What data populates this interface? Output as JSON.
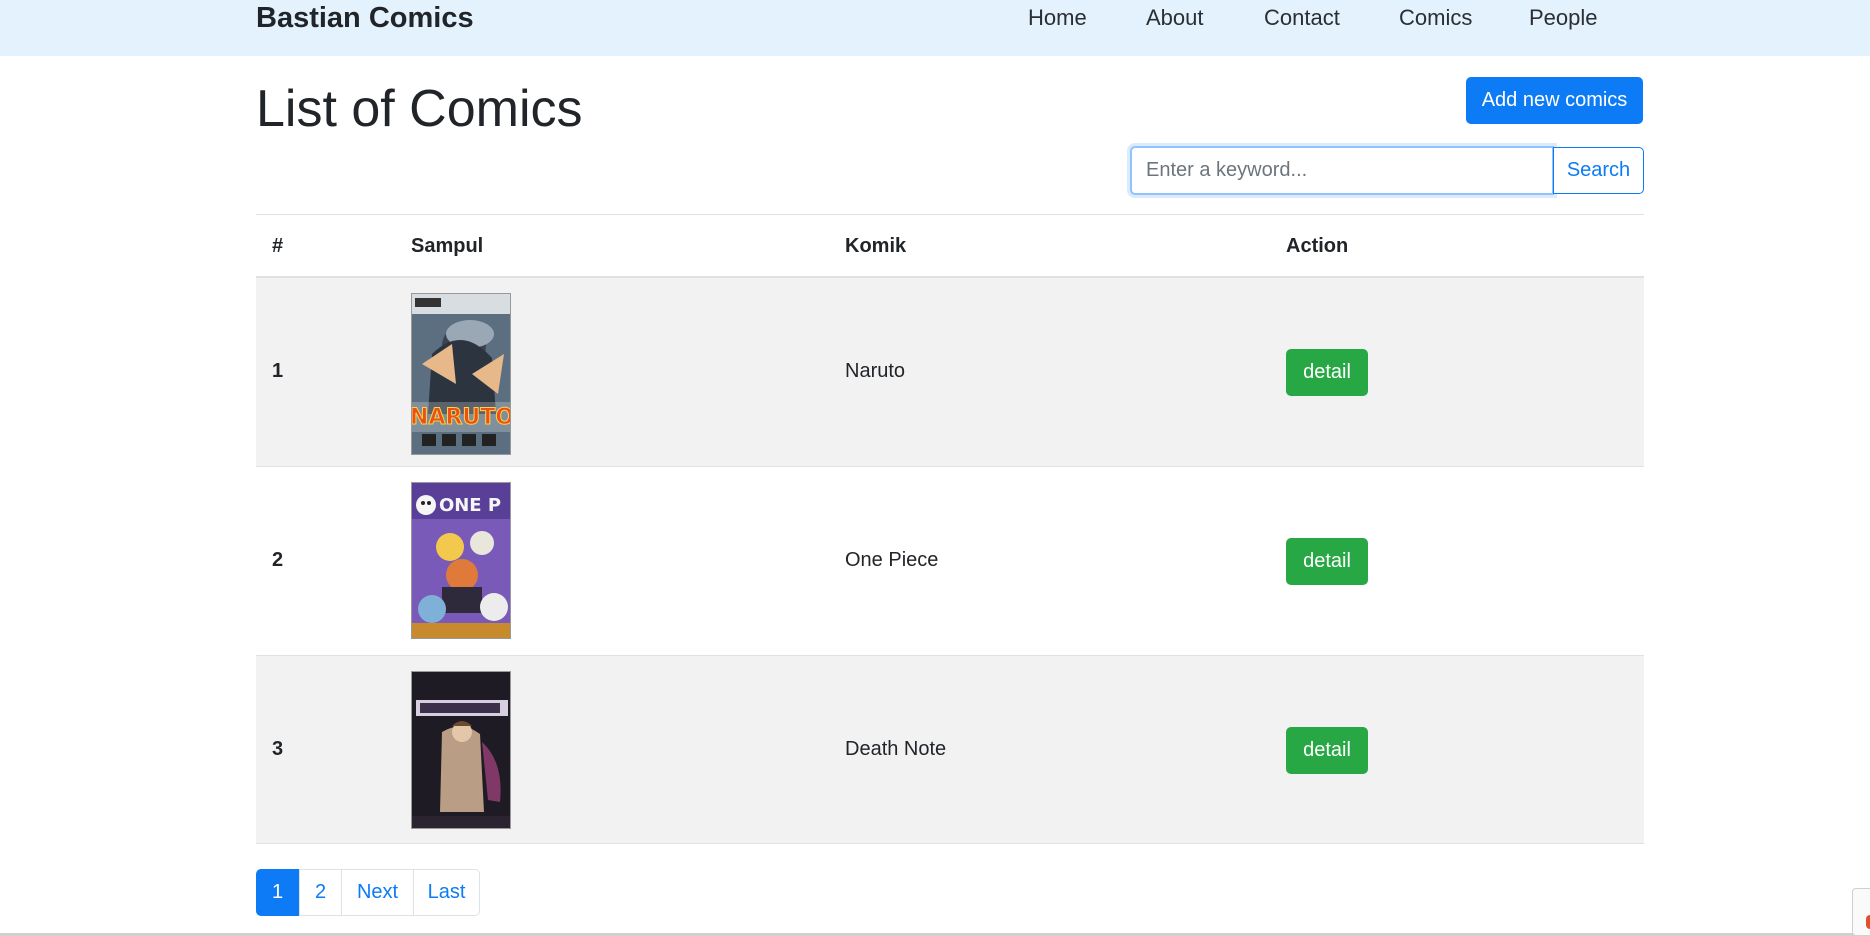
{
  "navbar": {
    "brand": "Bastian Comics",
    "links": [
      "Home",
      "About",
      "Contact",
      "Comics",
      "People"
    ]
  },
  "page": {
    "title": "List of Comics",
    "add_button_label": "Add new comics"
  },
  "search": {
    "placeholder": "Enter a keyword...",
    "value": "",
    "button_label": "Search"
  },
  "table": {
    "headers": [
      "#",
      "Sampul",
      "Komik",
      "Action"
    ],
    "rows": [
      {
        "number": "1",
        "cover_icon": "naruto-cover-image",
        "title": "Naruto",
        "action_label": "detail"
      },
      {
        "number": "2",
        "cover_icon": "one-piece-cover-image",
        "title": "One Piece",
        "action_label": "detail"
      },
      {
        "number": "3",
        "cover_icon": "death-note-cover-image",
        "title": "Death Note",
        "action_label": "detail"
      }
    ]
  },
  "pagination": {
    "pages": [
      "1",
      "2"
    ],
    "active_page": "1",
    "next_label": "Next",
    "last_label": "Last"
  },
  "colors": {
    "navbar_bg": "#e3f2fd",
    "primary": "#0d7bf5",
    "success": "#28a745",
    "stripe": "#f2f2f2"
  }
}
